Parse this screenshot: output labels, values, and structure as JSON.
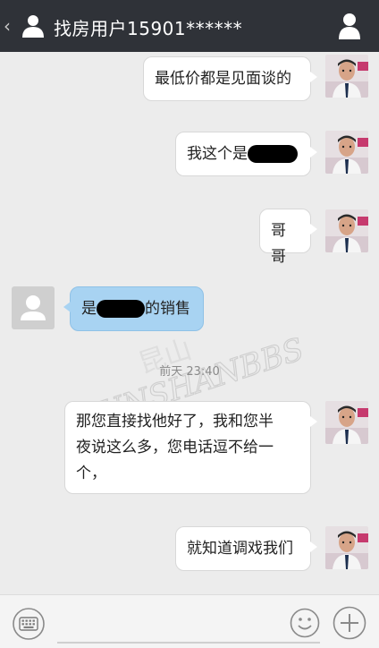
{
  "header": {
    "back_icon": "‹",
    "title": "找房用户15901******"
  },
  "messages": [
    {
      "side": "right",
      "text": "最低价都是见面谈的"
    },
    {
      "side": "right",
      "text_before": "我这个是",
      "text_after": ""
    },
    {
      "side": "right",
      "text": "哥哥"
    },
    {
      "side": "left",
      "text_before": "是",
      "text_after": "的销售"
    },
    {
      "side": "right",
      "lines": [
        "那您直接找他好了，我和您半",
        "夜说这么多，您电话逗不给一",
        "个，"
      ]
    },
    {
      "side": "right",
      "text": "就知道调戏我们"
    }
  ],
  "timestamp": "前天 23:40",
  "watermark": {
    "top": "昆山",
    "bottom": "KUNSHANBBS"
  },
  "colors": {
    "header_bg": "#2f3238",
    "chat_bg": "#ececec",
    "incoming_bubble": "#a8d3f2",
    "outgoing_bubble": "#ffffff"
  },
  "bottom_icons": [
    "keyboard-icon",
    "emoji-icon",
    "plus-icon"
  ]
}
